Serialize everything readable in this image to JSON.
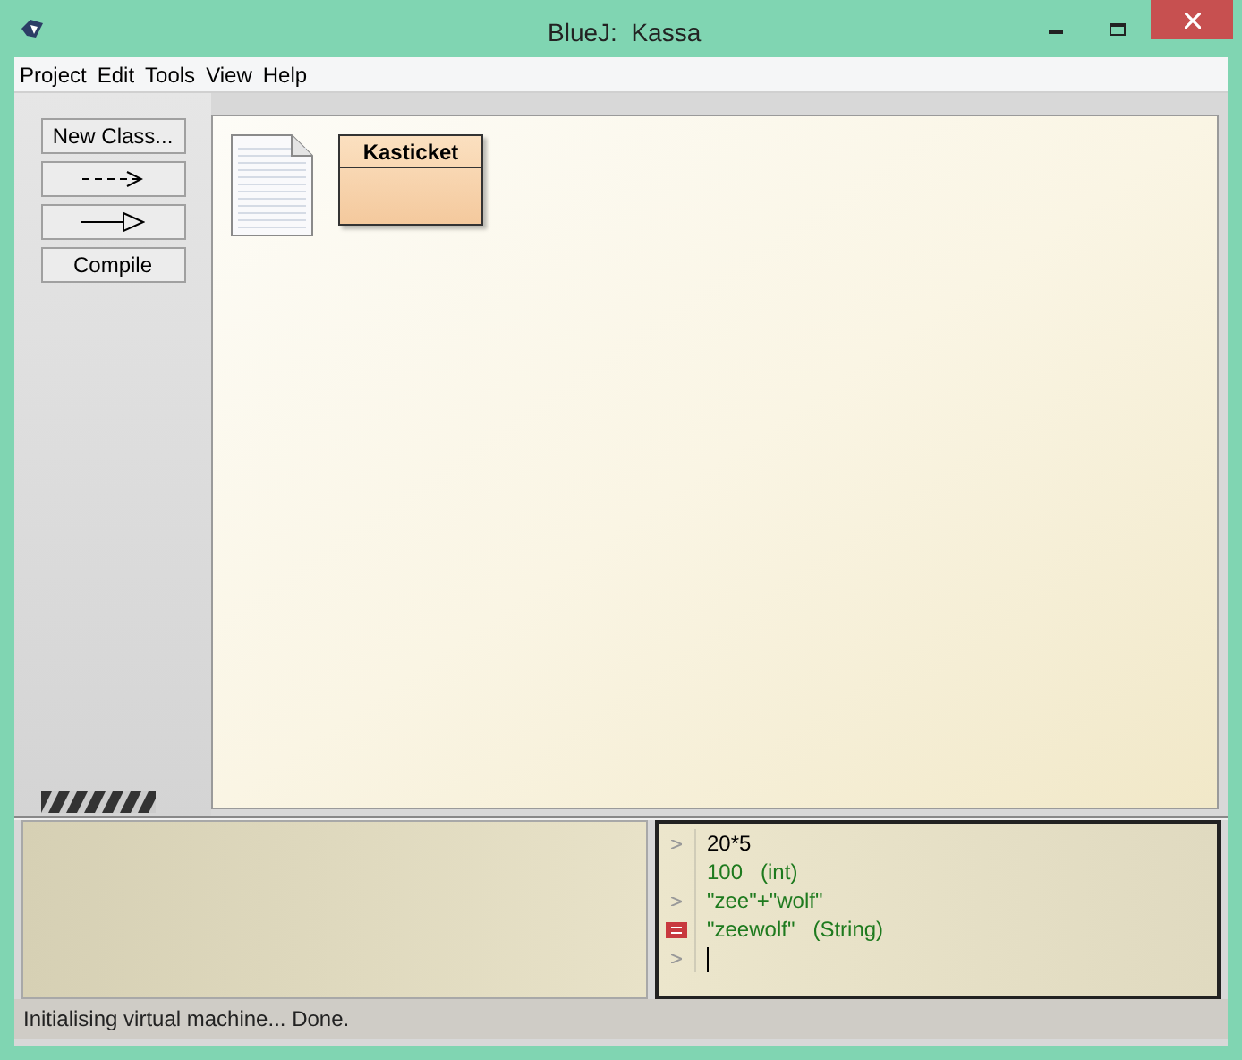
{
  "window": {
    "title": "BlueJ:  Kassa"
  },
  "menu": [
    "Project",
    "Edit",
    "Tools",
    "View",
    "Help"
  ],
  "toolbar": [
    {
      "kind": "text",
      "label": "New Class..."
    },
    {
      "kind": "uses-arrow"
    },
    {
      "kind": "inherits-arrow"
    },
    {
      "kind": "text",
      "label": "Compile"
    }
  ],
  "classes": [
    {
      "name": "Kasticket"
    }
  ],
  "codepad": [
    {
      "kind": "input",
      "text": "20*5",
      "color": "#000000"
    },
    {
      "kind": "result",
      "text": "100   (int)",
      "color": "#1e7a1e"
    },
    {
      "kind": "input",
      "text": "\"zee\"+\"wolf\"",
      "color": "#1e7a1e"
    },
    {
      "kind": "object-result",
      "text": "\"zeewolf\"   (String)",
      "color": "#1e7a1e"
    },
    {
      "kind": "prompt"
    }
  ],
  "status_bar": "Initialising virtual machine... Done."
}
